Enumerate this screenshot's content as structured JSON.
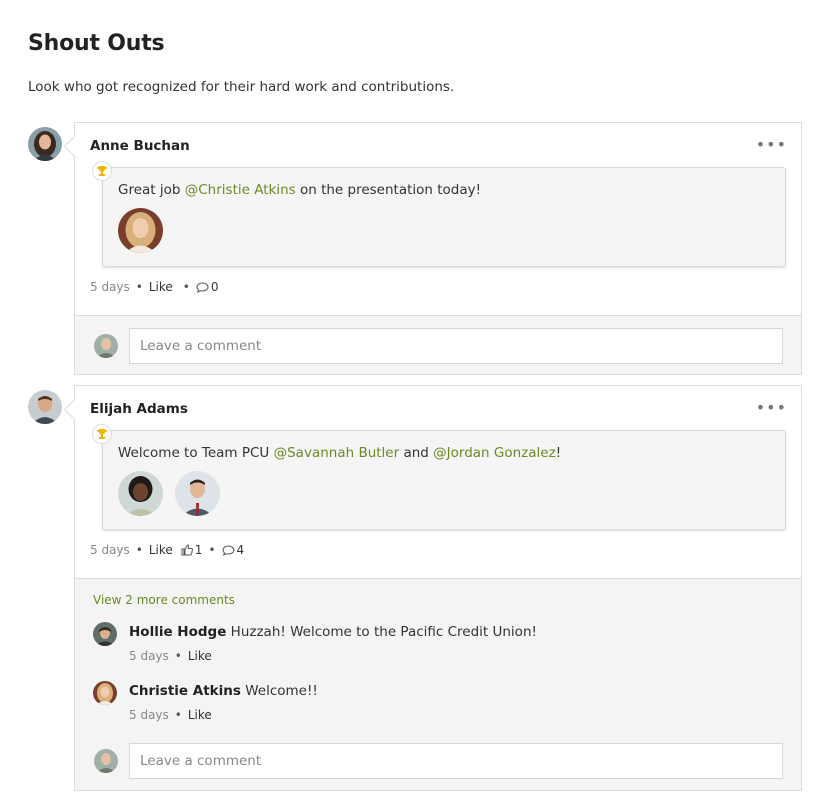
{
  "page": {
    "title": "Shout Outs",
    "subtitle": "Look who got recognized for their hard work and contributions."
  },
  "posts": [
    {
      "author": "Anne Buchan",
      "more_label": "•••",
      "shout": {
        "prefix": "Great job ",
        "mention1": "@Christie Atkins",
        "suffix": " on the presentation today!"
      },
      "meta": {
        "time": "5 days",
        "like_label": "Like",
        "comment_count": "0"
      },
      "comment_placeholder": "Leave a comment"
    },
    {
      "author": "Elijah Adams",
      "more_label": "•••",
      "shout": {
        "prefix": "Welcome to Team PCU ",
        "mention1": "@Savannah Butler",
        "middle": " and ",
        "mention2": "@Jordan Gonzalez",
        "suffix": "!"
      },
      "meta": {
        "time": "5 days",
        "like_label": "Like",
        "like_count": "1",
        "comment_count": "4"
      },
      "view_more": "View 2 more comments",
      "comments": [
        {
          "author": "Hollie Hodge",
          "text": " Huzzah! Welcome to the Pacific Credit Union!",
          "time": "5 days",
          "like_label": "Like"
        },
        {
          "author": "Christie Atkins",
          "text": " Welcome!!",
          "time": "5 days",
          "like_label": "Like"
        }
      ],
      "comment_placeholder": "Leave a comment"
    }
  ],
  "colors": {
    "mention": "#6a8b25",
    "trophy": "#f2b705",
    "border": "#dcdcdc"
  }
}
